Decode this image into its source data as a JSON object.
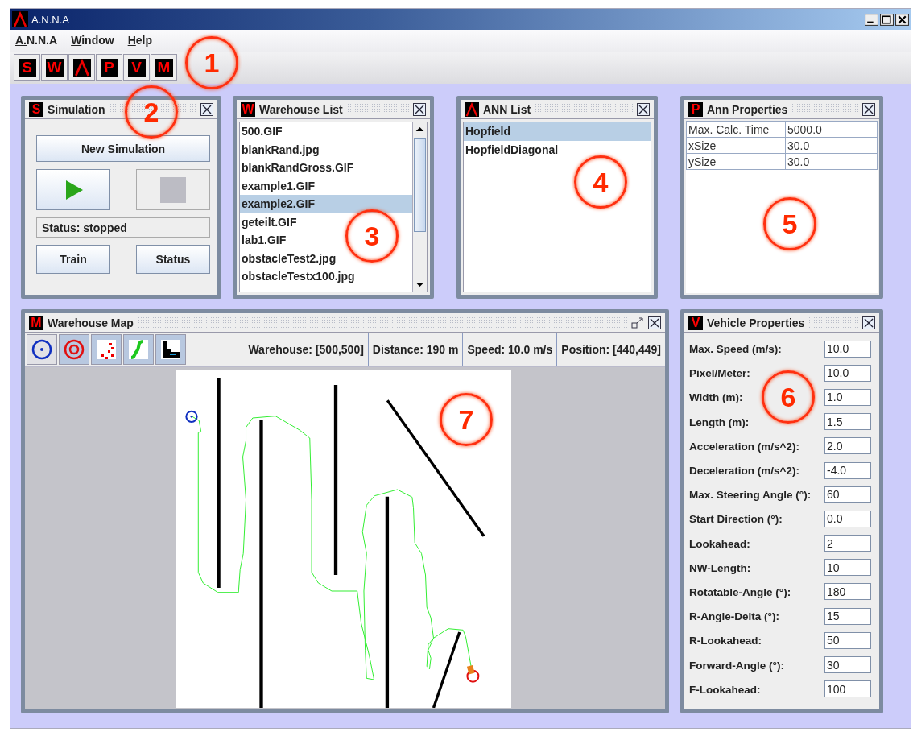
{
  "window": {
    "title": "A.N.N.A"
  },
  "menu": [
    "A.N.N.A",
    "Window",
    "Help"
  ],
  "toolbar": [
    {
      "kind": "letter",
      "text": "S"
    },
    {
      "kind": "letter",
      "text": "W"
    },
    {
      "kind": "logo"
    },
    {
      "kind": "letter",
      "text": "P"
    },
    {
      "kind": "letter",
      "text": "V"
    },
    {
      "kind": "letter",
      "text": "M"
    }
  ],
  "simulation": {
    "title": "Simulation",
    "icon": {
      "kind": "letter",
      "text": "S"
    },
    "new_button": "New Simulation",
    "play": {
      "disabled": false
    },
    "stop": {
      "disabled": true
    },
    "status": "Status: stopped",
    "train_button": "Train",
    "status_button": "Status"
  },
  "warehouse_list": {
    "title": "Warehouse List",
    "icon": {
      "kind": "letter",
      "text": "W"
    },
    "items": [
      {
        "label": "500.GIF",
        "selected": false
      },
      {
        "label": "blankRand.jpg",
        "selected": false
      },
      {
        "label": "blankRandGross.GIF",
        "selected": false
      },
      {
        "label": "example1.GIF",
        "selected": false
      },
      {
        "label": "example2.GIF",
        "selected": true
      },
      {
        "label": "geteilt.GIF",
        "selected": false
      },
      {
        "label": "lab1.GIF",
        "selected": false
      },
      {
        "label": "obstacleTest2.jpg",
        "selected": false
      },
      {
        "label": "obstacleTestx100.jpg",
        "selected": false
      }
    ]
  },
  "ann_list": {
    "title": "ANN List",
    "icon": {
      "kind": "logo"
    },
    "items": [
      {
        "label": "Hopfield",
        "selected": true
      },
      {
        "label": "HopfieldDiagonal",
        "selected": false
      }
    ]
  },
  "ann_properties": {
    "title": "Ann Properties",
    "icon": {
      "kind": "letter",
      "text": "P"
    },
    "rows": [
      [
        "Max. Calc. Time",
        "5000.0"
      ],
      [
        "xSize",
        "30.0"
      ],
      [
        "ySize",
        "30.0"
      ]
    ]
  },
  "warehouse_map": {
    "title": "Warehouse Map",
    "icon": {
      "kind": "letter",
      "text": "M"
    },
    "tools": [
      {
        "kind": "start",
        "selected": false
      },
      {
        "kind": "target",
        "selected": true
      },
      {
        "kind": "sensors",
        "selected": true
      },
      {
        "kind": "path",
        "selected": true
      },
      {
        "kind": "map",
        "selected": true
      }
    ],
    "readouts": [
      "Warehouse: [500,500]",
      "Distance: 190 m",
      "Speed: 10.0 m/s",
      "Position: [440,449]"
    ]
  },
  "vehicle_properties": {
    "title": "Vehicle Properties",
    "icon": {
      "kind": "letter",
      "text": "V"
    },
    "fields": [
      {
        "label": "Max. Speed (m/s):",
        "value": "10.0"
      },
      {
        "label": "Pixel/Meter:",
        "value": "10.0"
      },
      {
        "label": "Width (m):",
        "value": "1.0"
      },
      {
        "label": "Length (m):",
        "value": "1.5"
      },
      {
        "label": "Acceleration (m/s^2):",
        "value": "2.0"
      },
      {
        "label": "Deceleration (m/s^2):",
        "value": "-4.0"
      },
      {
        "label": "Max. Steering Angle (°):",
        "value": "60"
      },
      {
        "label": "Start Direction (°):",
        "value": "0.0"
      },
      {
        "label": "Lookahead:",
        "value": "2"
      },
      {
        "label": "NW-Length:",
        "value": "10"
      },
      {
        "label": "Rotatable-Angle (°):",
        "value": "180"
      },
      {
        "label": "R-Angle-Delta (°):",
        "value": "15"
      },
      {
        "label": "R-Lookahead:",
        "value": "50"
      },
      {
        "label": "Forward-Angle (°):",
        "value": "30"
      },
      {
        "label": "F-Lookahead:",
        "value": "100"
      }
    ]
  },
  "callouts": [
    "1",
    "2",
    "3",
    "4",
    "5",
    "6",
    "7"
  ]
}
